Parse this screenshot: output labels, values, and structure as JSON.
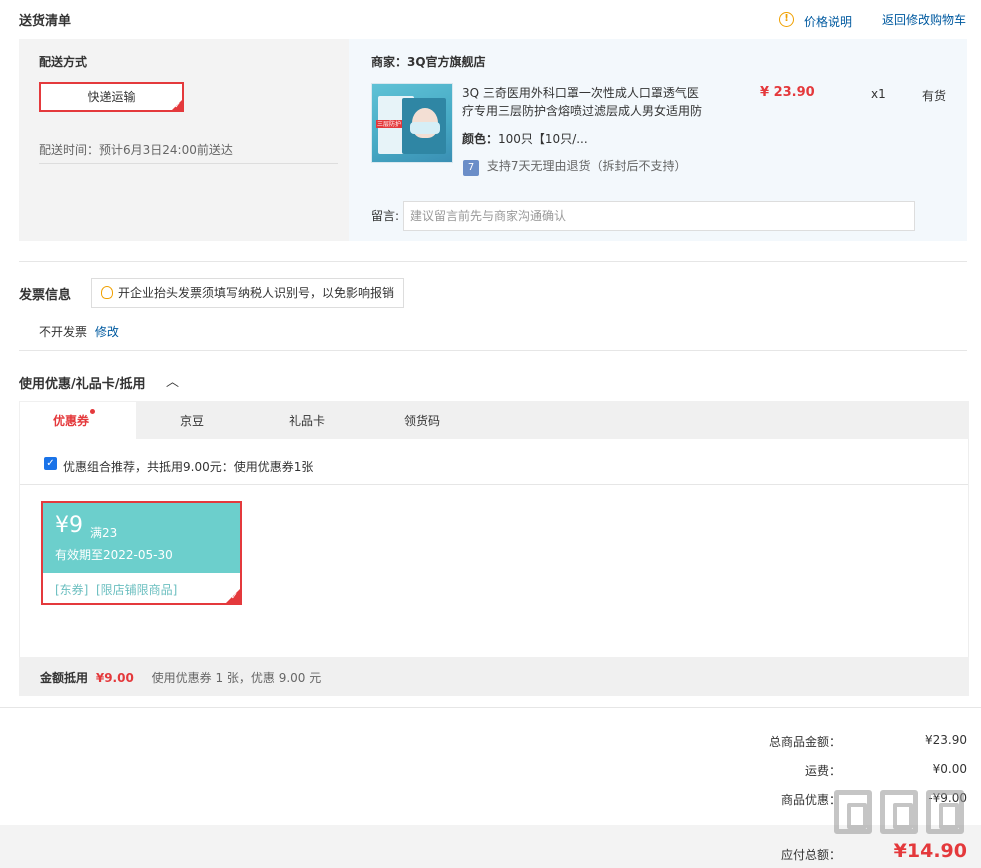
{
  "header": {
    "title": "送货清单",
    "price_note": "价格说明",
    "back_to_cart": "返回修改购物车"
  },
  "shipping": {
    "method_label": "配送方式",
    "method_value": "快递运输",
    "time_text": "配送时间：预计6月3日24:00前送达"
  },
  "merchant": {
    "label": "商家：3Q官方旗舰店"
  },
  "product": {
    "title_line1": "3Q 三奇医用外科口罩一次性成人口罩透气医",
    "title_line2": "疗专用三层防护含熔喷过滤层成人男女适用防",
    "price": "¥ 23.90",
    "qty": "x1",
    "stock": "有货",
    "color_label": "颜色：",
    "color_value": "100只【10只/...",
    "return_badge": "7",
    "return_text": "支持7天无理由退货（拆封后不支持）",
    "img_caption": "三层防护"
  },
  "remark": {
    "label": "留言:",
    "placeholder": "建议留言前先与商家沟通确认"
  },
  "invoice": {
    "title": "发票信息",
    "tip": "开企业抬头发票须填写纳税人识别号，以免影响报销",
    "status": "不开发票",
    "edit": "修改"
  },
  "discount": {
    "title": "使用优惠/礼品卡/抵用",
    "tabs": [
      "优惠券",
      "京豆",
      "礼品卡",
      "领货码"
    ],
    "recommend_text": "优惠组合推荐，共抵用9.00元：使用优惠券1张",
    "coupon": {
      "amount": "¥9",
      "condition": "满23",
      "expiry": "有效期至2022-05-30",
      "tags": "[东券]  [限店铺限商品]"
    },
    "summary_label": "金额抵用",
    "summary_amount": "¥9.00",
    "summary_desc": "使用优惠券 1 张，优惠 9.00 元"
  },
  "totals": {
    "goods_label": "总商品金额：",
    "goods_value": "¥23.90",
    "freight_label": "运费：",
    "freight_value": "¥0.00",
    "discount_label": "商品优惠：",
    "discount_value": "-¥9.00",
    "pay_label": "应付总额：",
    "pay_value": "¥14.90"
  },
  "colors": {
    "accent_red": "#e4393c",
    "link_blue": "#005aa0",
    "coupon_teal": "#6ccfcc"
  }
}
